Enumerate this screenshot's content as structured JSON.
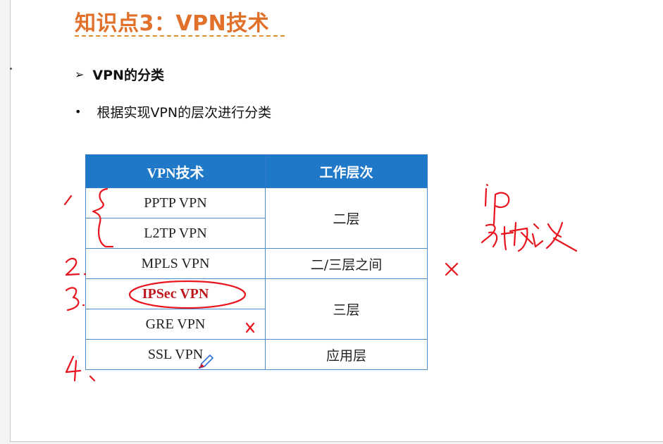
{
  "slide": {
    "title": "知识点3：VPN技术",
    "heading_marker": "➢",
    "heading": "VPN的分类",
    "bullet_marker": "•",
    "bullet": "根据实现VPN的层次进行分类"
  },
  "table": {
    "headers": [
      "VPN技术",
      "工作层次"
    ],
    "rows": [
      {
        "tech": "PPTP VPN",
        "layer": "二层"
      },
      {
        "tech": "L2TP VPN",
        "layer": ""
      },
      {
        "tech": "MPLS VPN",
        "layer": "二/三层之间"
      },
      {
        "tech": "IPSec  VPN",
        "layer": "三层"
      },
      {
        "tech": "GRE  VPN",
        "layer": ""
      },
      {
        "tech": "SSL VPN",
        "layer": "应用层"
      }
    ]
  },
  "colors": {
    "title": "#e0702a",
    "table_header": "#1f78c8",
    "highlight": "#c0161e",
    "ink": "#e8141e"
  }
}
